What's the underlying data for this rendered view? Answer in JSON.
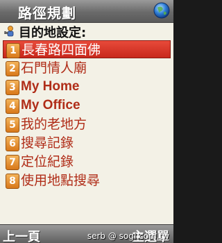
{
  "titlebar": {
    "title": "路徑規劃",
    "icon": "globe-icon"
  },
  "header": {
    "label": "目的地設定:",
    "icon": "person-key-icon"
  },
  "menu": {
    "items": [
      {
        "num": "1",
        "label": "長春路四面佛",
        "selected": true
      },
      {
        "num": "2",
        "label": "石門情人廟",
        "selected": false
      },
      {
        "num": "3",
        "label": "My Home",
        "selected": false
      },
      {
        "num": "4",
        "label": "My Office",
        "selected": false
      },
      {
        "num": "5",
        "label": "我的老地方",
        "selected": false
      },
      {
        "num": "6",
        "label": "搜尋記錄",
        "selected": false
      },
      {
        "num": "7",
        "label": "定位紀錄",
        "selected": false
      },
      {
        "num": "8",
        "label": "使用地點搜尋",
        "selected": false
      }
    ]
  },
  "softkeys": {
    "left": "上一頁",
    "right": "主選單"
  },
  "watermark": "serb @ sogi.com.tw",
  "colors": {
    "selected_bg": "#d8321f",
    "item_text": "#b02d18",
    "badge": "#e08a2a",
    "background": "#f3f1e6"
  }
}
